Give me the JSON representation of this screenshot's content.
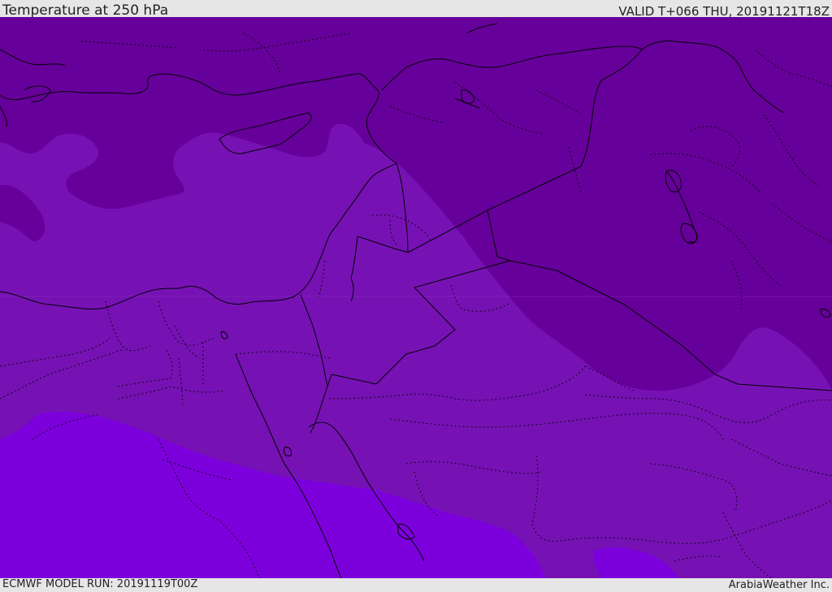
{
  "header": {
    "title": "Temperature at 250 hPa",
    "valid": "VALID T+066 THU, 20191121T18Z"
  },
  "footer": {
    "model_run": "ECMWF MODEL RUN: 20191119T00Z",
    "credit": "ArabiaWeather Inc."
  },
  "colors": {
    "band_dark": "#66009a",
    "band_mid": "#7612b4",
    "band_light": "#7c00dc",
    "coastline": "#000000",
    "border": "#1a0a2a"
  }
}
